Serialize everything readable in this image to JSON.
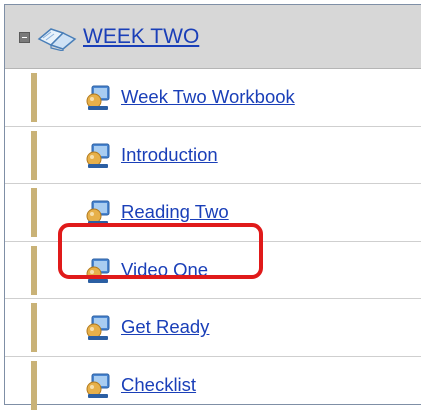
{
  "week": {
    "title": "WEEK TWO",
    "expanded": true,
    "icons": {
      "toggle": "collapse-icon",
      "section": "book-icon"
    }
  },
  "items": [
    {
      "label": "Week Two Workbook",
      "icon": "resource-icon"
    },
    {
      "label": "Introduction",
      "icon": "resource-icon"
    },
    {
      "label": "Reading Two",
      "icon": "resource-icon"
    },
    {
      "label": "Video One",
      "icon": "resource-icon",
      "highlighted": true
    },
    {
      "label": "Get Ready",
      "icon": "resource-icon"
    },
    {
      "label": "Checklist",
      "icon": "resource-icon"
    }
  ],
  "colors": {
    "link": "#1a3fb8",
    "header_bg": "#d7d7d7",
    "accent_bar": "#c9b277",
    "highlight": "#e01a1a"
  }
}
